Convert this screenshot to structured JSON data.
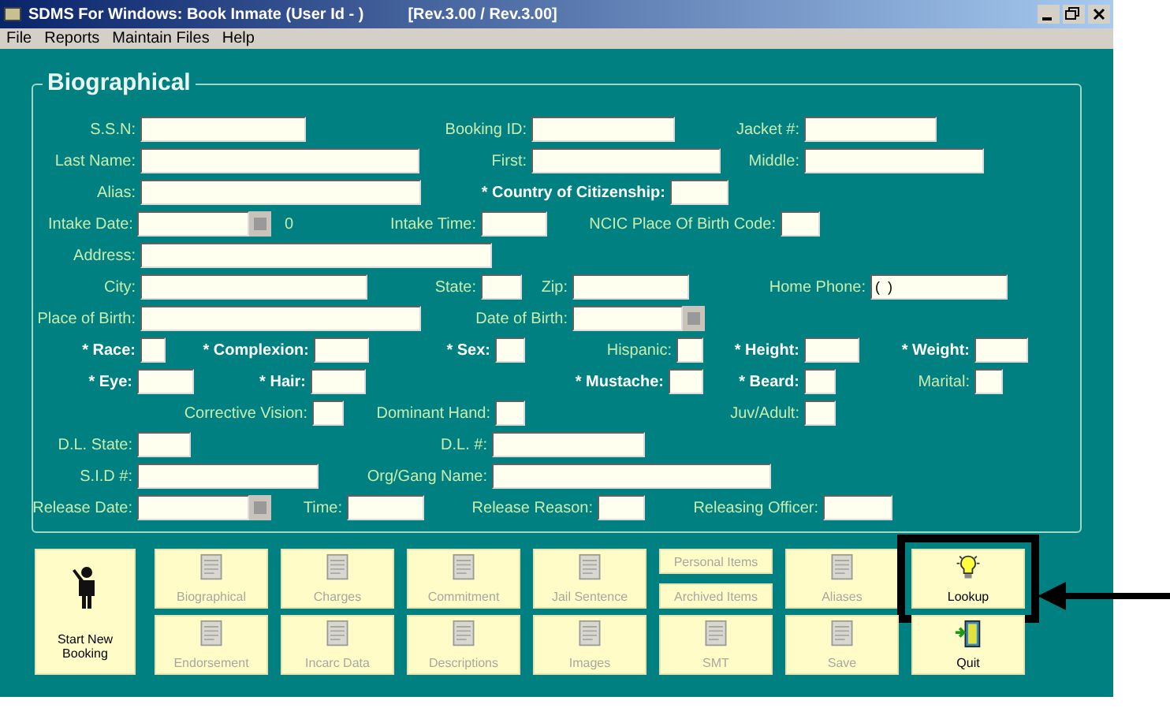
{
  "window": {
    "title": "SDMS For Windows: Book Inmate   (User Id - )",
    "version": "[Rev.3.00 / Rev.3.00]"
  },
  "menu": [
    "File",
    "Reports",
    "Maintain Files",
    "Help"
  ],
  "section": {
    "title": "Biographical"
  },
  "rows": [
    [
      {
        "label": "S.S.N:",
        "kind": "text"
      },
      {
        "label": "Booking ID:",
        "kind": "text"
      },
      {
        "label": "Jacket #:",
        "kind": "text"
      }
    ],
    [
      {
        "label": "Last Name:",
        "kind": "text"
      },
      {
        "label": "First:",
        "kind": "text"
      },
      {
        "label": "Middle:",
        "kind": "text"
      }
    ],
    [
      {
        "label": "Alias:",
        "kind": "text"
      },
      {
        "label": "* Country of Citizenship:",
        "kind": "text",
        "required": true
      }
    ],
    [
      {
        "label": "Intake Date:",
        "kind": "date",
        "suffix": "0"
      },
      {
        "label": "Intake Time:",
        "kind": "text"
      },
      {
        "label": "NCIC Place Of Birth Code:",
        "kind": "text"
      }
    ],
    [
      {
        "label": "Address:",
        "kind": "text"
      }
    ],
    [
      {
        "label": "City:",
        "kind": "text"
      },
      {
        "label": "State:",
        "kind": "text"
      },
      {
        "label": "Zip:",
        "kind": "text"
      },
      {
        "label": "Home Phone:",
        "kind": "text",
        "value": "(  )"
      }
    ],
    [
      {
        "label": "Place of Birth:",
        "kind": "text"
      },
      {
        "label": "Date of Birth:",
        "kind": "date"
      }
    ],
    [
      {
        "label": "* Race:",
        "kind": "text",
        "required": true
      },
      {
        "label": "* Complexion:",
        "kind": "text",
        "required": true
      },
      {
        "label": "* Sex:",
        "kind": "text",
        "required": true
      },
      {
        "label": "Hispanic:",
        "kind": "text"
      },
      {
        "label": "* Height:",
        "kind": "text",
        "required": true
      },
      {
        "label": "* Weight:",
        "kind": "text",
        "required": true
      }
    ],
    [
      {
        "label": "* Eye:",
        "kind": "text",
        "required": true
      },
      {
        "label": "* Hair:",
        "kind": "text",
        "required": true
      },
      {
        "label": "* Mustache:",
        "kind": "text",
        "required": true
      },
      {
        "label": "* Beard:",
        "kind": "text",
        "required": true
      },
      {
        "label": "Marital:",
        "kind": "text"
      }
    ],
    [
      {
        "label": "Corrective Vision:",
        "kind": "text"
      },
      {
        "label": "Dominant Hand:",
        "kind": "text"
      },
      {
        "label": "Juv/Adult:",
        "kind": "text"
      }
    ],
    [
      {
        "label": "D.L. State:",
        "kind": "text"
      },
      {
        "label": "D.L. #:",
        "kind": "text"
      }
    ],
    [
      {
        "label": "S.I.D #:",
        "kind": "text"
      },
      {
        "label": "Org/Gang Name:",
        "kind": "text"
      }
    ],
    [
      {
        "label": "Release Date:",
        "kind": "date"
      },
      {
        "label": "Time:",
        "kind": "text"
      },
      {
        "label": "Release Reason:",
        "kind": "text"
      },
      {
        "label": "Releasing Officer:",
        "kind": "text"
      }
    ]
  ],
  "start_button": {
    "label": "Start New Booking",
    "disabled": false
  },
  "button_rows": [
    [
      {
        "kind": "icon",
        "label": "Biographical",
        "disabled": true,
        "highlighted": false
      },
      {
        "kind": "icon",
        "label": "Charges",
        "disabled": true,
        "highlighted": false
      },
      {
        "kind": "icon",
        "label": "Commitment",
        "disabled": true,
        "highlighted": false
      },
      {
        "kind": "icon",
        "label": "Jail Sentence",
        "disabled": true,
        "highlighted": false
      },
      {
        "kind": "stack",
        "items": [
          {
            "label": "Personal Items",
            "disabled": true
          },
          {
            "label": "Archived Items",
            "disabled": true
          }
        ]
      },
      {
        "kind": "icon",
        "label": "Aliases",
        "disabled": true,
        "highlighted": false
      },
      {
        "kind": "icon",
        "label": "Lookup",
        "disabled": false,
        "highlighted": true
      }
    ],
    [
      {
        "kind": "icon",
        "label": "Endorsement",
        "disabled": true,
        "highlighted": false
      },
      {
        "kind": "icon",
        "label": "Incarc Data",
        "disabled": true,
        "highlighted": false
      },
      {
        "kind": "icon",
        "label": "Descriptions",
        "disabled": true,
        "highlighted": false
      },
      {
        "kind": "icon",
        "label": "Images",
        "disabled": true,
        "highlighted": false
      },
      {
        "kind": "icon",
        "label": "SMT",
        "disabled": true,
        "highlighted": false
      },
      {
        "kind": "icon",
        "label": "Save",
        "disabled": true,
        "highlighted": false
      },
      {
        "kind": "icon",
        "label": "Quit",
        "disabled": false,
        "highlighted": false
      }
    ]
  ]
}
